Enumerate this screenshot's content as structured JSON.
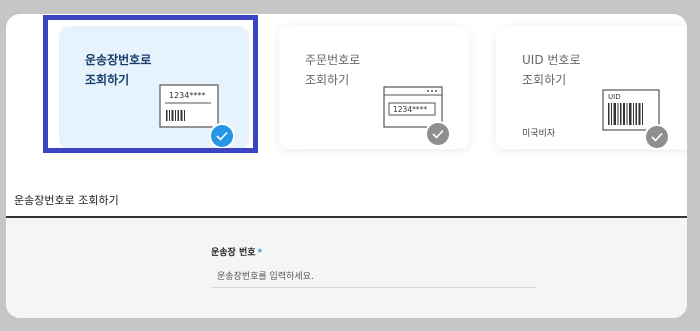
{
  "cards": [
    {
      "title": "운송장번호로\n조회하기",
      "illustration_text": "1234****",
      "selected": true,
      "check_color": "#2596e3"
    },
    {
      "title": "주문번호로\n조회하기",
      "illustration_text": "1234****",
      "selected": false,
      "check_color": "#8f8f8f"
    },
    {
      "title": "UID 번호로\n조회하기",
      "illustration_text": "UID",
      "subtitle": "미국비자",
      "selected": false,
      "check_color": "#8f8f8f"
    }
  ],
  "section": {
    "title": "운송장번호로 조회하기"
  },
  "form": {
    "label": "운송장 번호",
    "required_mark": "*",
    "placeholder": "운송장번호를 입력하세요."
  },
  "colors": {
    "selected_card_bg": "#e6f2fc",
    "selection_outline": "#3d44c4",
    "accent": "#2596e3"
  }
}
